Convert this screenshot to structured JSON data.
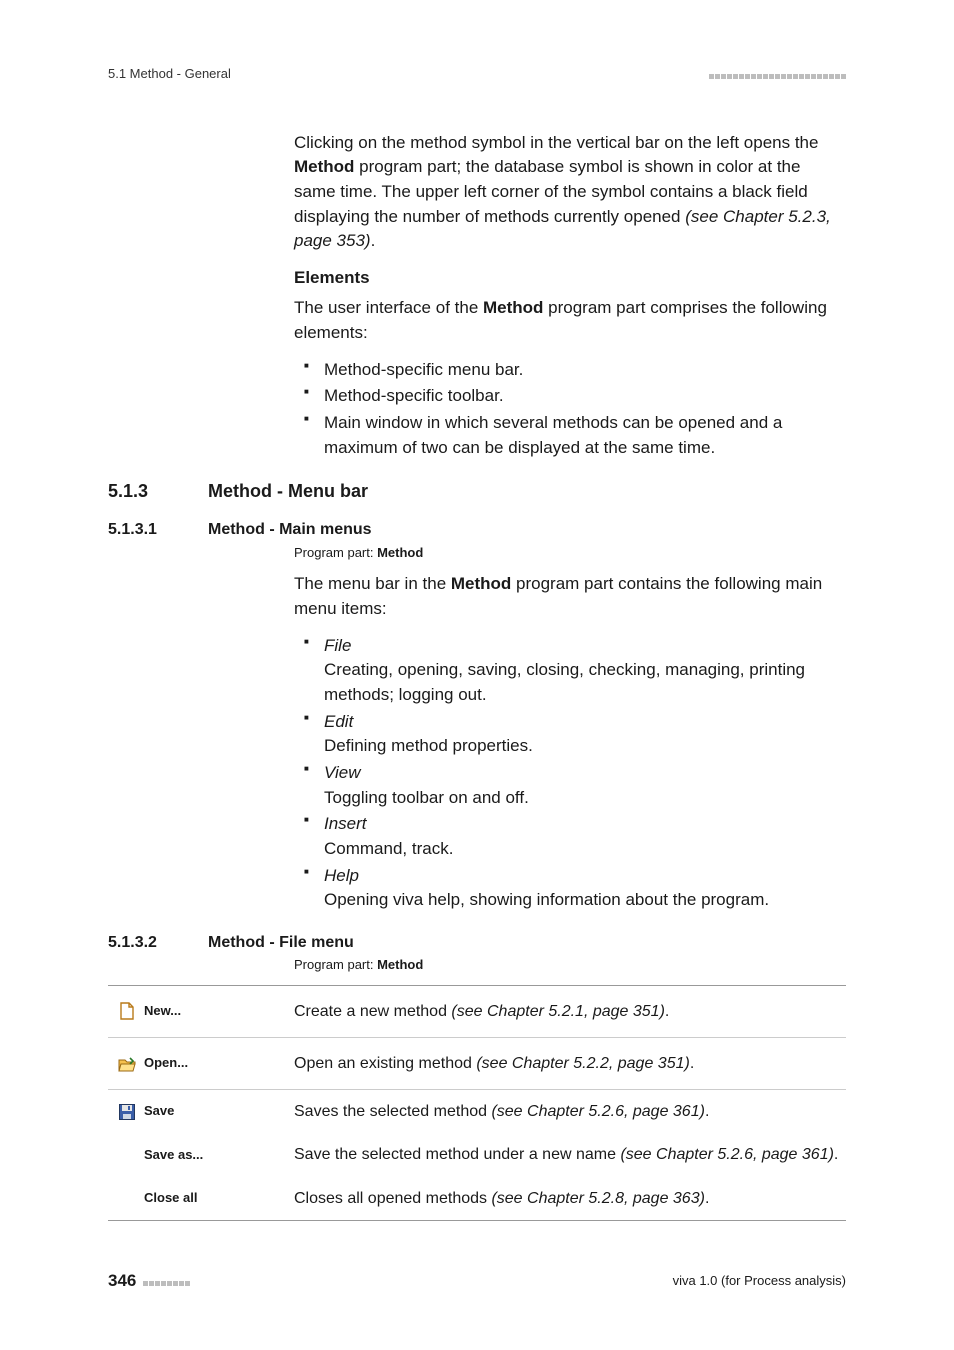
{
  "header": {
    "left": "5.1 Method - General"
  },
  "intro": {
    "p1_a": "Clicking on the method symbol in the vertical bar on the left opens the ",
    "p1_bold": "Method",
    "p1_b": " program part; the database symbol is shown in color at the same time. The upper left corner of the symbol contains a black field displaying the number of methods currently opened ",
    "p1_italic": "(see Chapter 5.2.3, page 353)",
    "p1_c": "."
  },
  "elements": {
    "heading": "Elements",
    "lead_a": "The user interface of the ",
    "lead_bold": "Method",
    "lead_b": " program part comprises the following elements:",
    "items": [
      "Method-specific menu bar.",
      "Method-specific toolbar.",
      "Main window in which several methods can be opened and a maximum of two can be displayed at the same time."
    ]
  },
  "sec513": {
    "num": "5.1.3",
    "title": "Method - Menu bar"
  },
  "sec5131": {
    "num": "5.1.3.1",
    "title": "Method - Main menus",
    "pp_label": "Program part: ",
    "pp_val": "Method",
    "lead_a": "The menu bar in the ",
    "lead_bold": "Method",
    "lead_b": " program part contains the following main menu items:",
    "menus": [
      {
        "term": "File",
        "desc": "Creating, opening, saving, closing, checking, managing, printing methods; logging out."
      },
      {
        "term": "Edit",
        "desc": "Defining method properties."
      },
      {
        "term": "View",
        "desc": "Toggling toolbar on and off."
      },
      {
        "term": "Insert",
        "desc": "Command, track."
      },
      {
        "term": "Help",
        "desc": "Opening viva help, showing information about the program."
      }
    ]
  },
  "sec5132": {
    "num": "5.1.3.2",
    "title": "Method - File menu",
    "pp_label": "Program part: ",
    "pp_val": "Method",
    "rows": [
      {
        "label": "New...",
        "desc_a": "Create a new method ",
        "desc_i": "(see Chapter 5.2.1, page 351)",
        "icon": "new"
      },
      {
        "label": "Open...",
        "desc_a": "Open an existing method ",
        "desc_i": "(see Chapter 5.2.2, page 351)",
        "icon": "open"
      },
      {
        "label": "Save",
        "desc_a": "Saves the selected method ",
        "desc_i": "(see Chapter 5.2.6, page 361)",
        "icon": "save"
      },
      {
        "label": "Save as...",
        "desc_a": "Save the selected method under a new name ",
        "desc_i": "(see Chapter 5.2.6, page 361)",
        "icon": ""
      },
      {
        "label": "Close all",
        "desc_a": "Closes all opened methods ",
        "desc_i": "(see Chapter 5.2.8, page 363)",
        "icon": ""
      }
    ]
  },
  "footer": {
    "page": "346",
    "right": "viva 1.0 (for Process analysis)"
  }
}
